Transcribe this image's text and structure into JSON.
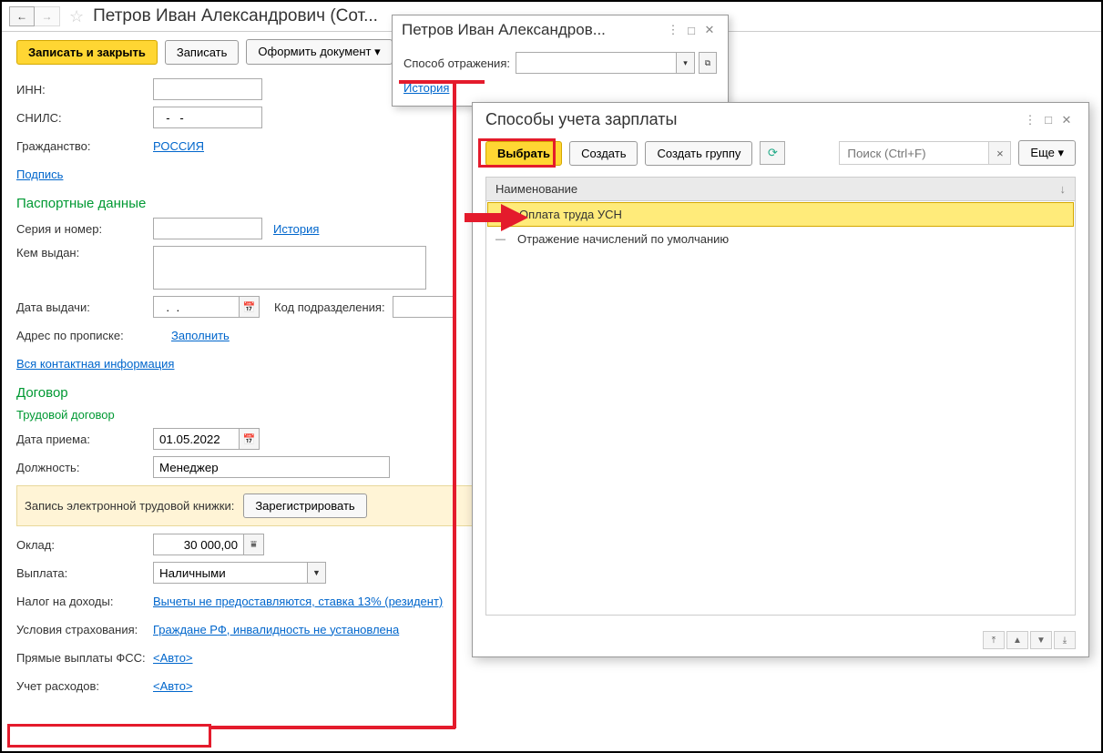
{
  "header": {
    "title": "Петров Иван Александрович (Сот..."
  },
  "toolbar": {
    "save_close": "Записать и закрыть",
    "save": "Записать",
    "create_doc": "Оформить документ ▾"
  },
  "form": {
    "inn_label": "ИНН:",
    "inn_value": "",
    "snils_label": "СНИЛС:",
    "snils_value": "  -   -",
    "citizenship_label": "Гражданство:",
    "citizenship_link": "РОССИЯ",
    "signature_link": "Подпись",
    "passport_section": "Паспортные данные",
    "series_label": "Серия и номер:",
    "series_value": "",
    "history_link": "История",
    "issued_by_label": "Кем выдан:",
    "issued_by_value": "",
    "issue_date_label": "Дата выдачи:",
    "issue_date_value": "  .  .",
    "dept_code_label": "Код подразделения:",
    "dept_code_value": "",
    "address_label": "Адрес по прописке:",
    "fill_link": "Заполнить",
    "all_contacts_link": "Вся контактная информация",
    "contract_section": "Договор",
    "employment_contract": "Трудовой договор",
    "hire_date_label": "Дата приема:",
    "hire_date_value": "01.05.2022",
    "position_label": "Должность:",
    "position_value": "Менеджер",
    "workbook_note": "Запись электронной трудовой книжки:",
    "register_btn": "Зарегистрировать",
    "salary_label": "Оклад:",
    "salary_value": "30 000,00",
    "payment_label": "Выплата:",
    "payment_value": "Наличными",
    "tax_label": "Налог на доходы:",
    "tax_link": "Вычеты не предоставляются, ставка 13% (резидент)",
    "insurance_label": "Условия страхования:",
    "insurance_link": "Граждане РФ, инвалидность не установлена",
    "fss_label": "Прямые выплаты ФСС:",
    "fss_link": "<Авто>",
    "expenses_label": "Учет расходов:",
    "expenses_link": "<Авто>"
  },
  "modal1": {
    "title": "Петров Иван Александров...",
    "method_label": "Способ отражения:",
    "method_value": "",
    "history_link": "История"
  },
  "modal2": {
    "title": "Способы учета зарплаты",
    "select_btn": "Выбрать",
    "create_btn": "Создать",
    "create_group_btn": "Создать группу",
    "search_placeholder": "Поиск (Ctrl+F)",
    "more_btn": "Еще ▾",
    "column_name": "Наименование",
    "rows": [
      {
        "icon": "—",
        "text": "Оплата труда УСН",
        "selected": true
      },
      {
        "icon": "—",
        "text": "Отражение начислений по умолчанию",
        "selected": false
      }
    ]
  }
}
